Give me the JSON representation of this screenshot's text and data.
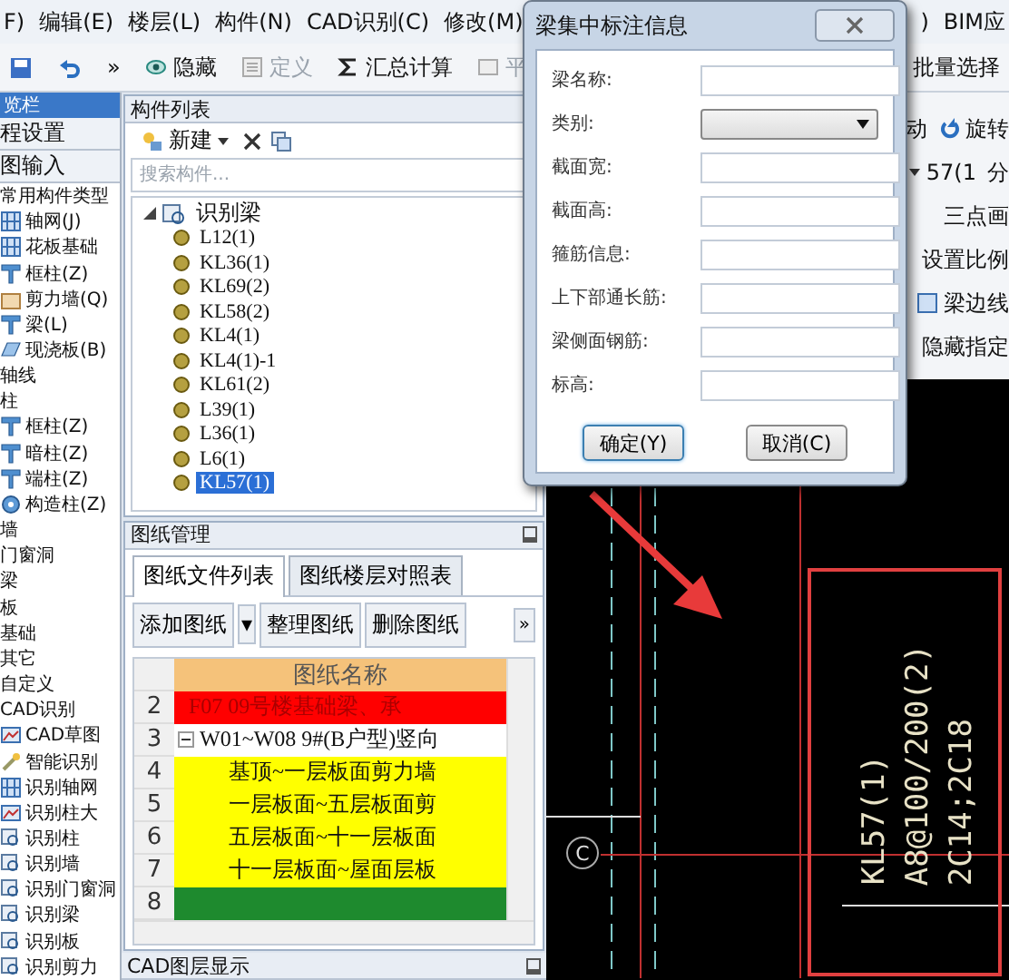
{
  "menu": {
    "left": [
      "F)",
      "编辑(E)",
      "楼层(L)",
      "构件(N)",
      "CAD识别(C)",
      "修改(M)"
    ],
    "right": [
      ")",
      "BIM应"
    ]
  },
  "toolbar": {
    "items": [
      {
        "kind": "save"
      },
      {
        "kind": "undo"
      },
      {
        "kind": "more",
        "label": "»"
      },
      {
        "kind": "eye",
        "label": "隐藏",
        "disabled": false
      },
      {
        "kind": "define",
        "label": "定义",
        "disabled": true
      },
      {
        "kind": "sum",
        "label": "汇总计算",
        "disabled": false
      },
      {
        "kind": "flat",
        "label": "平",
        "disabled": true
      }
    ],
    "right": "批量选择"
  },
  "nav_panel": {
    "title": "览栏",
    "sections": [
      "程设置",
      "图输入"
    ],
    "tree": [
      {
        "label": "常用构件类型",
        "children": [
          {
            "label": "轴网(J)",
            "kind": "grid"
          },
          {
            "label": "花板基础",
            "kind": "grid"
          },
          {
            "label": "框柱(Z)",
            "kind": "column"
          },
          {
            "label": "剪力墙(Q)",
            "kind": "wall"
          },
          {
            "label": "梁(L)",
            "kind": "column"
          },
          {
            "label": "现浇板(B)",
            "kind": "slab"
          }
        ]
      },
      {
        "label": "轴线"
      },
      {
        "label": "柱",
        "children": [
          {
            "label": "框柱(Z)",
            "kind": "column"
          },
          {
            "label": "暗柱(Z)",
            "kind": "column"
          },
          {
            "label": "端柱(Z)",
            "kind": "column"
          },
          {
            "label": "构造柱(Z)",
            "kind": "gear"
          }
        ]
      },
      {
        "label": "墙"
      },
      {
        "label": "门窗洞"
      },
      {
        "label": "梁"
      },
      {
        "label": "板"
      },
      {
        "label": "基础"
      },
      {
        "label": "其它"
      },
      {
        "label": "自定义"
      },
      {
        "label": "CAD识别",
        "children": [
          {
            "label": "CAD草图",
            "kind": "cad"
          },
          {
            "label": "智能识别",
            "kind": "wand"
          },
          {
            "label": "识别轴网",
            "kind": "grid"
          },
          {
            "label": "识别柱大",
            "kind": "cad"
          },
          {
            "label": "识别柱",
            "kind": "find"
          },
          {
            "label": "识别墙",
            "kind": "find"
          },
          {
            "label": "识别门窗洞",
            "kind": "find"
          },
          {
            "label": "识别梁",
            "kind": "find"
          },
          {
            "label": "识别板",
            "kind": "find"
          },
          {
            "label": "识别剪力",
            "kind": "find"
          }
        ]
      }
    ]
  },
  "component_list": {
    "title": "构件列表",
    "new_label": "新建",
    "search": {
      "placeholder": "搜索构件..."
    },
    "tree": {
      "label": "识别梁",
      "expanded": true,
      "children": [
        {
          "label": "L12(1)",
          "selected": false
        },
        {
          "label": "KL36(1)",
          "selected": false
        },
        {
          "label": "KL69(2)",
          "selected": false
        },
        {
          "label": "KL58(2)",
          "selected": false
        },
        {
          "label": "KL4(1)",
          "selected": false
        },
        {
          "label": "KL4(1)-1",
          "selected": false
        },
        {
          "label": "KL61(2)",
          "selected": false
        },
        {
          "label": "L39(1)",
          "selected": false
        },
        {
          "label": "L36(1)",
          "selected": false
        },
        {
          "label": "L6(1)",
          "selected": false
        },
        {
          "label": "KL57(1)",
          "selected": true
        }
      ]
    }
  },
  "side_toolbar": [
    {
      "label": "动",
      "kind": "plain"
    },
    {
      "label": "旋转",
      "kind": "rotate"
    },
    {
      "label": "57(1",
      "kind": "dropdown"
    },
    {
      "label": "分",
      "kind": "plain"
    },
    {
      "label": "三点画",
      "kind": "plain"
    },
    {
      "label": "设置比例",
      "kind": "plain"
    },
    {
      "label": "梁边线",
      "kind": "box"
    },
    {
      "label": "隐藏指定",
      "kind": "plain"
    }
  ],
  "drawings": {
    "title": "图纸管理",
    "tabs": [
      {
        "label": "图纸文件列表",
        "selected": true
      },
      {
        "label": "图纸楼层对照表",
        "selected": false
      }
    ],
    "buttons": [
      {
        "kind": "button",
        "label": "添加图纸"
      },
      {
        "kind": "dropdown",
        "label": "▾"
      },
      {
        "kind": "button",
        "label": "整理图纸"
      },
      {
        "kind": "button",
        "label": "删除图纸"
      }
    ],
    "more": "»",
    "table": {
      "column": "图纸名称",
      "rows": [
        {
          "number": "2",
          "name": "F07 09号楼基础梁、承",
          "color": "#ff0000"
        },
        {
          "number": "3",
          "name": "W01~W08 9#(B户型)竖向",
          "color": "#ffffff",
          "expanded": true
        },
        {
          "number": "4",
          "name": "基顶~一层板面剪力墙",
          "color": "#ffff00"
        },
        {
          "number": "5",
          "name": "一层板面~五层板面剪",
          "color": "#ffff00"
        },
        {
          "number": "6",
          "name": "五层板面~十一层板面",
          "color": "#ffff00"
        },
        {
          "number": "7",
          "name": "十一层板面~屋面层板",
          "color": "#ffff00"
        },
        {
          "number": "8",
          "color": "#1e8a2e"
        }
      ]
    }
  },
  "layer_panel": {
    "title": "CAD图层显示"
  },
  "cad": {
    "labels": [
      "KL57(1)",
      "A8@100/200(2)",
      "2C14;2C18"
    ],
    "axis": "C"
  },
  "dialog": {
    "title": "梁集中标注信息",
    "fields": [
      {
        "label": "梁名称:",
        "kind": "text"
      },
      {
        "label": "类别:",
        "kind": "select"
      },
      {
        "label": "截面宽:",
        "kind": "text"
      },
      {
        "label": "截面高:",
        "kind": "text"
      },
      {
        "label": "箍筋信息:",
        "kind": "text"
      },
      {
        "label": "上下部通长筋:",
        "kind": "text"
      },
      {
        "label": "梁侧面钢筋:",
        "kind": "text"
      },
      {
        "label": "标高:",
        "kind": "text"
      }
    ],
    "buttons": [
      {
        "label": "确定(Y)",
        "default": true
      },
      {
        "label": "取消(C)",
        "default": false
      }
    ]
  }
}
